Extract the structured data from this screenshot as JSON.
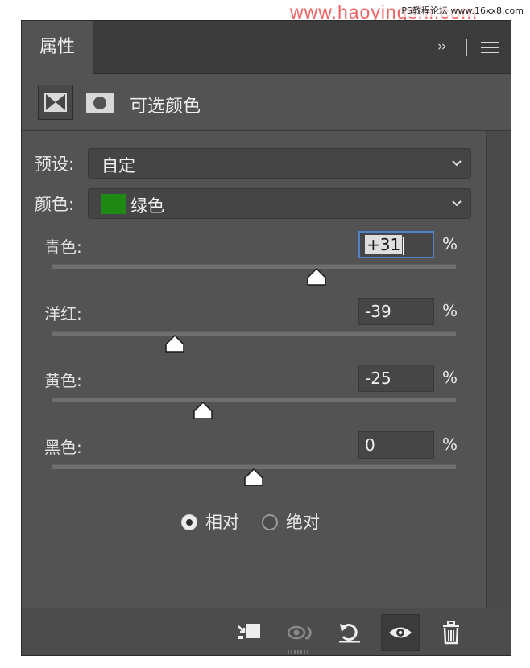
{
  "watermark": {
    "main": "www.haoyingshi.com",
    "small": "PS教程论坛 www.16xx8.com"
  },
  "panel": {
    "tab_label": "属性",
    "collapse_glyph": "››",
    "menu_icon": "menu-icon",
    "adjustment_icon": "selective-color-icon",
    "mask_icon": "layer-mask-icon",
    "adjustment_title": "可选颜色"
  },
  "preset": {
    "label": "预设:",
    "value": "自定"
  },
  "colors": {
    "label": "颜色:",
    "value": "绿色",
    "swatch": "#1e8a13"
  },
  "sliders": [
    {
      "label": "青色:",
      "value": "+31",
      "numeric": 31,
      "unit": "%",
      "focused": true
    },
    {
      "label": "洋红:",
      "value": "-39",
      "numeric": -39,
      "unit": "%",
      "focused": false
    },
    {
      "label": "黄色:",
      "value": "-25",
      "numeric": -25,
      "unit": "%",
      "focused": false
    },
    {
      "label": "黑色:",
      "value": "0",
      "numeric": 0,
      "unit": "%",
      "focused": false
    }
  ],
  "method": {
    "options": [
      {
        "label": "相对",
        "selected": true
      },
      {
        "label": "绝对",
        "selected": false
      }
    ]
  },
  "bottom_toolbar": {
    "buttons": [
      "clip-to-layer-icon",
      "view-previous-state-icon",
      "reset-icon",
      "visibility-eye-icon",
      "trash-icon"
    ],
    "active": "visibility-eye-icon"
  },
  "colors_theme": {
    "panel_bg": "#535353",
    "focus_blue": "#4e84c7"
  }
}
